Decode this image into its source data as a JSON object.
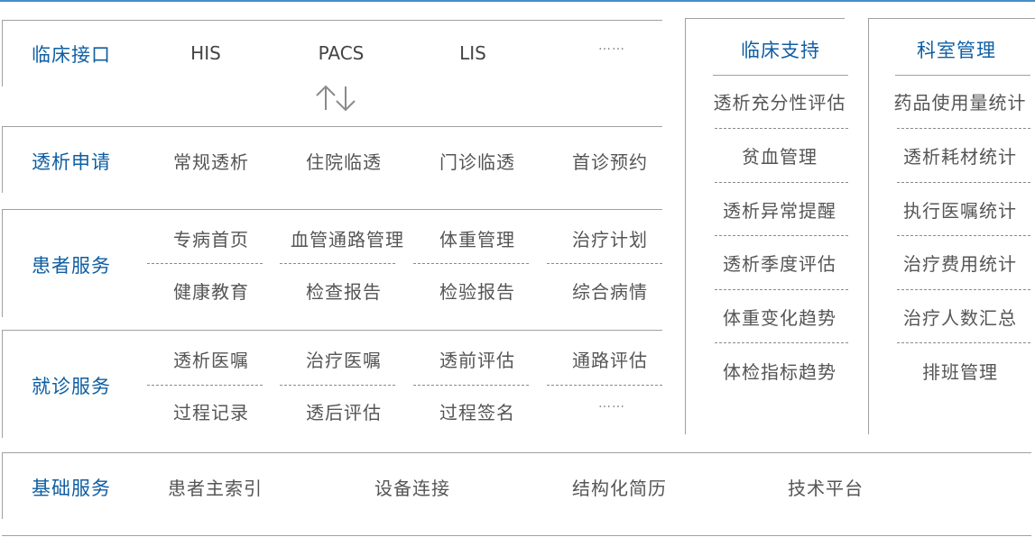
{
  "interface": {
    "label": "临床接口",
    "items": [
      "HIS",
      "PACS",
      "LIS",
      "……"
    ]
  },
  "dialysis_request": {
    "label": "透析申请",
    "items": [
      "常规透析",
      "住院临透",
      "门诊临透",
      "首诊预约"
    ]
  },
  "patient_service": {
    "label": "患者服务",
    "row1": [
      "专病首页",
      "血管通路管理",
      "体重管理",
      "治疗计划"
    ],
    "row2": [
      "健康教育",
      "检查报告",
      "检验报告",
      "综合病情"
    ]
  },
  "visit_service": {
    "label": "就诊服务",
    "row1": [
      "透析医嘱",
      "治疗医嘱",
      "透前评估",
      "通路评估"
    ],
    "row2": [
      "过程记录",
      "透后评估",
      "过程签名",
      "……"
    ]
  },
  "base_service": {
    "label": "基础服务",
    "items": [
      "患者主索引",
      "设备连接",
      "结构化简历",
      "技术平台"
    ]
  },
  "clinical_support": {
    "title": "临床支持",
    "items": [
      "透析充分性评估",
      "贫血管理",
      "透析异常提醒",
      "透析季度评估",
      "体重变化趋势",
      "体检指标趋势"
    ]
  },
  "dept_management": {
    "title": "科室管理",
    "items": [
      "药品使用量统计",
      "透析耗材统计",
      "执行医嘱统计",
      "治疗费用统计",
      "治疗人数汇总",
      "排班管理"
    ]
  },
  "icons": {
    "exchange": "arrows-up-down-icon"
  },
  "colors": {
    "accent": "#0f5ea3",
    "line": "#a0a0a0",
    "text": "#555555"
  }
}
